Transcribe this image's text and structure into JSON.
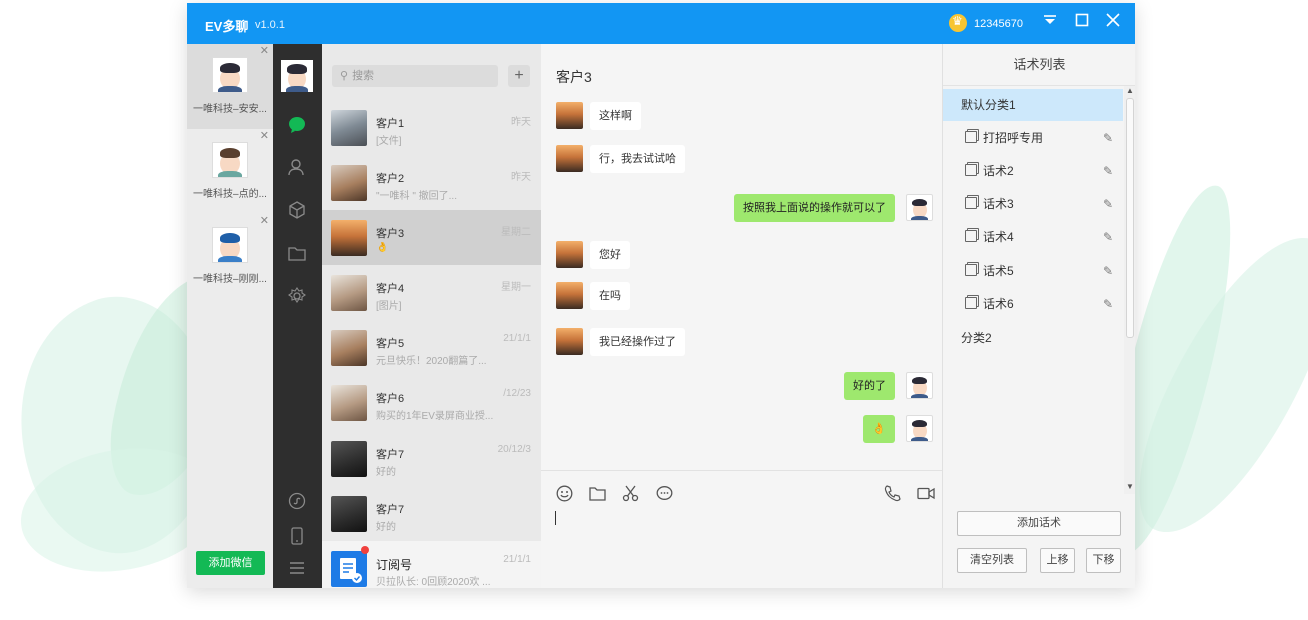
{
  "window": {
    "title": "EV多聊",
    "version": "v1.0.1",
    "account_id": "12345670"
  },
  "accounts": [
    {
      "label": "一唯科技–安安...",
      "active": true
    },
    {
      "label": "一唯科技–点的..."
    },
    {
      "label": "一唯科技–刚刚..."
    }
  ],
  "add_wechat_label": "添加微信",
  "search": {
    "placeholder": "搜索",
    "add": "+"
  },
  "chat_list": [
    {
      "name": "客户1",
      "preview": "[文件]",
      "time": "昨天"
    },
    {
      "name": "客户2",
      "preview": "\"一唯科 \" 撤回了...",
      "time": "昨天"
    },
    {
      "name": "客户3",
      "preview": "👌",
      "time": "星期二",
      "active": true
    },
    {
      "name": "客户4",
      "preview": "[图片]",
      "time": "星期一"
    },
    {
      "name": "客户5",
      "preview": "元旦快乐！2020翻篇了...",
      "time": "21/1/1"
    },
    {
      "name": "客户6",
      "preview": "购买的1年EV录屏商业授...",
      "time": "/12/23"
    },
    {
      "name": "客户7",
      "preview": "好的",
      "time": "20/12/3"
    },
    {
      "name": "客户7",
      "preview": "好的",
      "time": ""
    },
    {
      "name": "订阅号",
      "preview": "贝拉队长: 0回顾2020欢 ...",
      "time": "21/1/1"
    }
  ],
  "chat": {
    "title": "客户3",
    "messages": [
      {
        "dir": "in",
        "text": "这样啊"
      },
      {
        "dir": "in",
        "text": "行，我去试试哈"
      },
      {
        "dir": "out",
        "text": "按照我上面说的操作就可以了"
      },
      {
        "dir": "in",
        "text": "您好"
      },
      {
        "dir": "in",
        "text": "在吗"
      },
      {
        "dir": "in",
        "text": "我已经操作过了"
      },
      {
        "dir": "out",
        "text": "好的了"
      },
      {
        "dir": "out",
        "text": "👌"
      }
    ]
  },
  "scripts": {
    "title": "话术列表",
    "category1": "默认分类1",
    "items": [
      "打招呼专用",
      "话术2",
      "话术3",
      "话术4",
      "话术5",
      "话术6"
    ],
    "category2": "分类2",
    "add_button": "添加话术",
    "clear_button": "清空列表",
    "up_button": "上移",
    "down_button": "下移"
  },
  "colors": {
    "title_bar": "#1296f3",
    "accent_green": "#13b955",
    "out_bubble": "#9ee86e",
    "selected_category": "#cde8fb"
  }
}
